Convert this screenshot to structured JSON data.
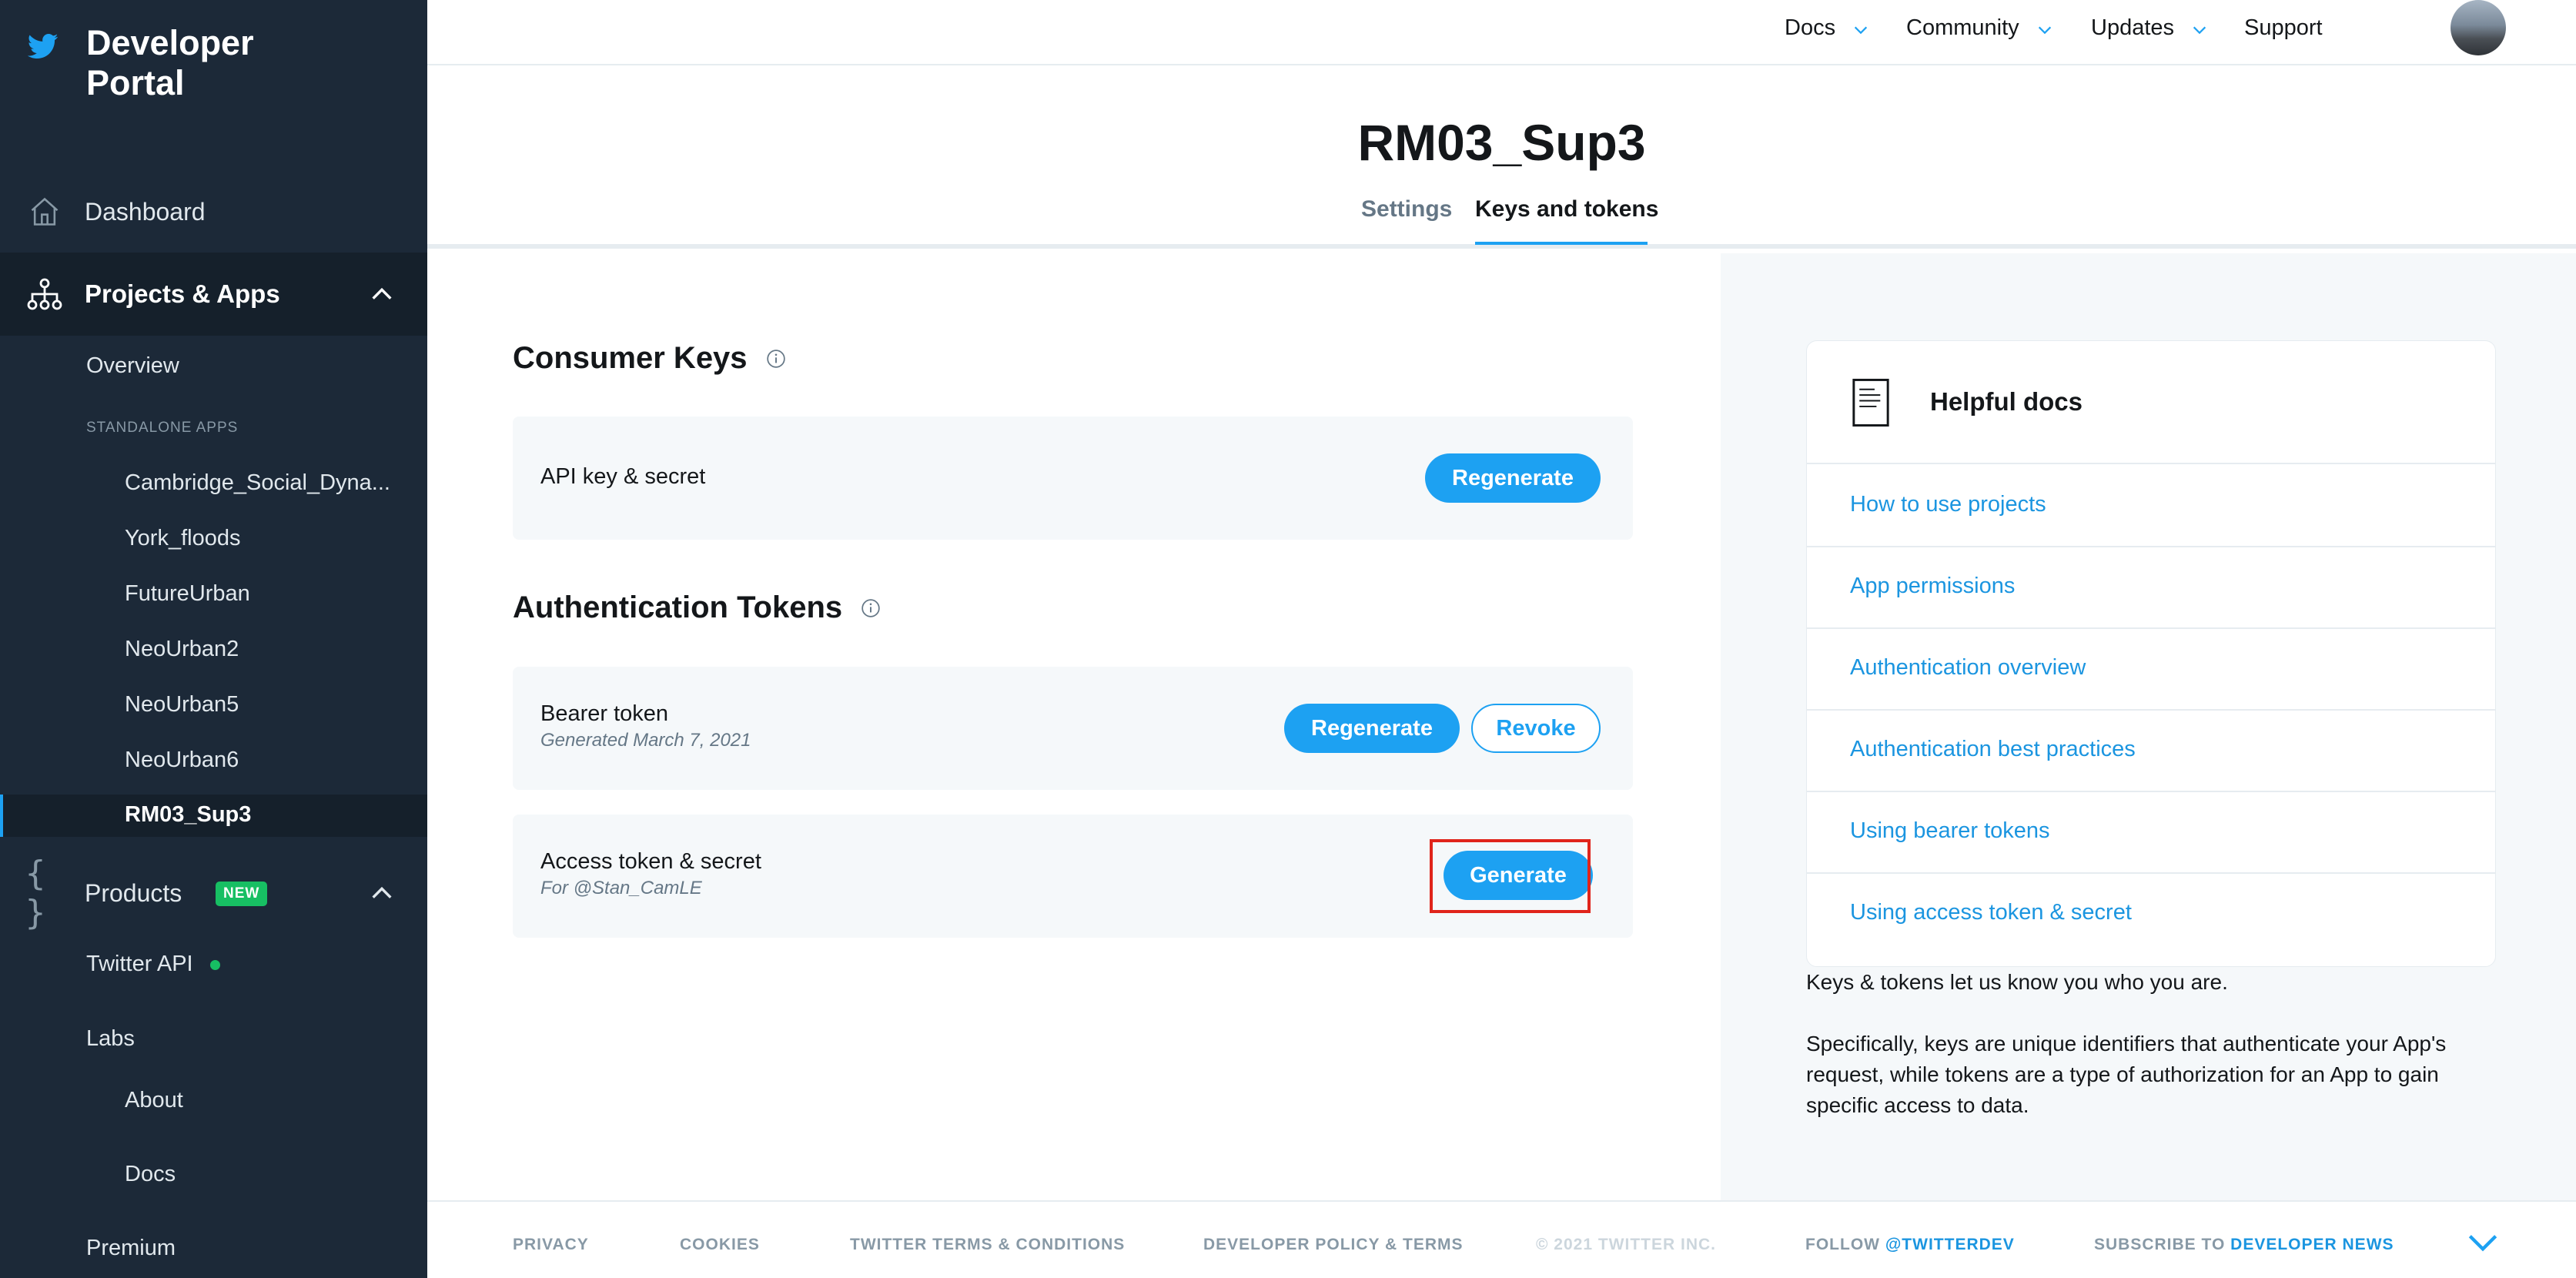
{
  "brand": {
    "title_line1": "Developer",
    "title_line2": "Portal"
  },
  "sidebar": {
    "dashboard": "Dashboard",
    "projects_apps": "Projects & Apps",
    "overview": "Overview",
    "standalone_header": "STANDALONE APPS",
    "apps": [
      "Cambridge_Social_Dyna...",
      "York_floods",
      "FutureUrban",
      "NeoUrban2",
      "NeoUrban5",
      "NeoUrban6"
    ],
    "active_app": "RM03_Sup3",
    "products": "Products",
    "new_badge": "NEW",
    "twitter_api": "Twitter API",
    "labs": "Labs",
    "about": "About",
    "docs": "Docs",
    "premium": "Premium"
  },
  "topnav": {
    "docs": "Docs",
    "community": "Community",
    "updates": "Updates",
    "support": "Support"
  },
  "header": {
    "title": "RM03_Sup3",
    "tab_settings": "Settings",
    "tab_keys": "Keys and tokens"
  },
  "consumer_keys": {
    "title": "Consumer Keys",
    "api_key_label": "API key & secret",
    "regenerate": "Regenerate"
  },
  "auth_tokens": {
    "title": "Authentication Tokens",
    "bearer_label": "Bearer token",
    "bearer_meta": "Generated March 7, 2021",
    "bearer_regenerate": "Regenerate",
    "bearer_revoke": "Revoke",
    "access_label": "Access token & secret",
    "access_meta": "For @Stan_CamLE",
    "generate": "Generate"
  },
  "helpful_docs": {
    "title": "Helpful docs",
    "links": [
      "How to use projects",
      "App permissions",
      "Authentication overview",
      "Authentication best practices",
      "Using bearer tokens",
      "Using access token & secret"
    ],
    "text1": "Keys & tokens let us know you who you are.",
    "text2": "Specifically, keys are unique identifiers that authenticate your App's request, while tokens are a type of authorization for an App to gain specific access to data."
  },
  "footer": {
    "privacy": "PRIVACY",
    "cookies": "COOKIES",
    "terms": "TWITTER TERMS & CONDITIONS",
    "policy": "DEVELOPER POLICY & TERMS",
    "copyright": "© 2021 TWITTER INC.",
    "follow": "FOLLOW",
    "follow_handle": "@TWITTERDEV",
    "subscribe": "SUBSCRIBE TO",
    "subscribe_link": "DEVELOPER NEWS"
  },
  "colors": {
    "sidebar_bg": "#1c2938",
    "accent": "#1da1f2",
    "link": "#1b95e0",
    "new_badge": "#17bf63",
    "highlight": "#e0241b"
  }
}
